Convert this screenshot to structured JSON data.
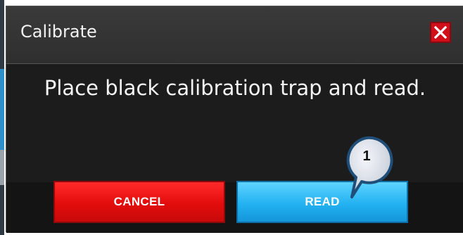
{
  "dialog": {
    "title": "Calibrate",
    "close_icon": "close-icon",
    "message": "Place black calibration trap and read."
  },
  "buttons": {
    "cancel_label": "CANCEL",
    "read_label": "READ"
  },
  "callout": {
    "number": "1"
  },
  "colors": {
    "dialog_bg": "#1c1c1c",
    "titlebar_bg": "#333333",
    "close_red": "#d10f1a",
    "cancel_red": "#e30c0c",
    "read_blue": "#23b2f2",
    "callout_fill": "#d8dde6",
    "callout_border": "#1f4e79"
  }
}
